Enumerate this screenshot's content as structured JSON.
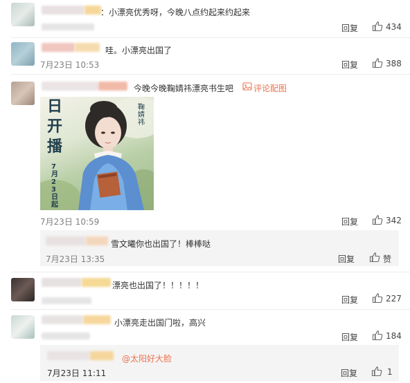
{
  "comments": [
    {
      "text": "：小漂亮优秀呀，今晚八点约起来约起来",
      "reply": "回复",
      "likes": "434"
    },
    {
      "text": "哇。小漂亮出国了",
      "time": "7月23日 10:53",
      "reply": "回复",
      "likes": "388"
    },
    {
      "text": "今晚今晚鞠婧祎漂亮书生吧",
      "pic_link": "评论配图",
      "time": "7月23日 10:59",
      "reply": "回复",
      "likes": "342",
      "poster": {
        "title_chars": [
          "日",
          "开",
          "播"
        ],
        "date_text": "7月23日起",
        "side_name": "鞠婧祎"
      }
    },
    {
      "text": "漂亮也出国了！！！！！",
      "reply": "回复",
      "likes": "227"
    },
    {
      "text": "小漂亮走出国门啦，高兴",
      "reply": "回复",
      "likes": "184"
    }
  ],
  "sub_replies": [
    {
      "text": "雪文曦你也出国了！棒棒哒",
      "time": "7月23日 13:35",
      "reply": "回复",
      "like_label": "赞"
    },
    {
      "text": "@太阳好大脸",
      "time": "7月23日 11:11",
      "reply": "回复",
      "likes": "1"
    }
  ]
}
